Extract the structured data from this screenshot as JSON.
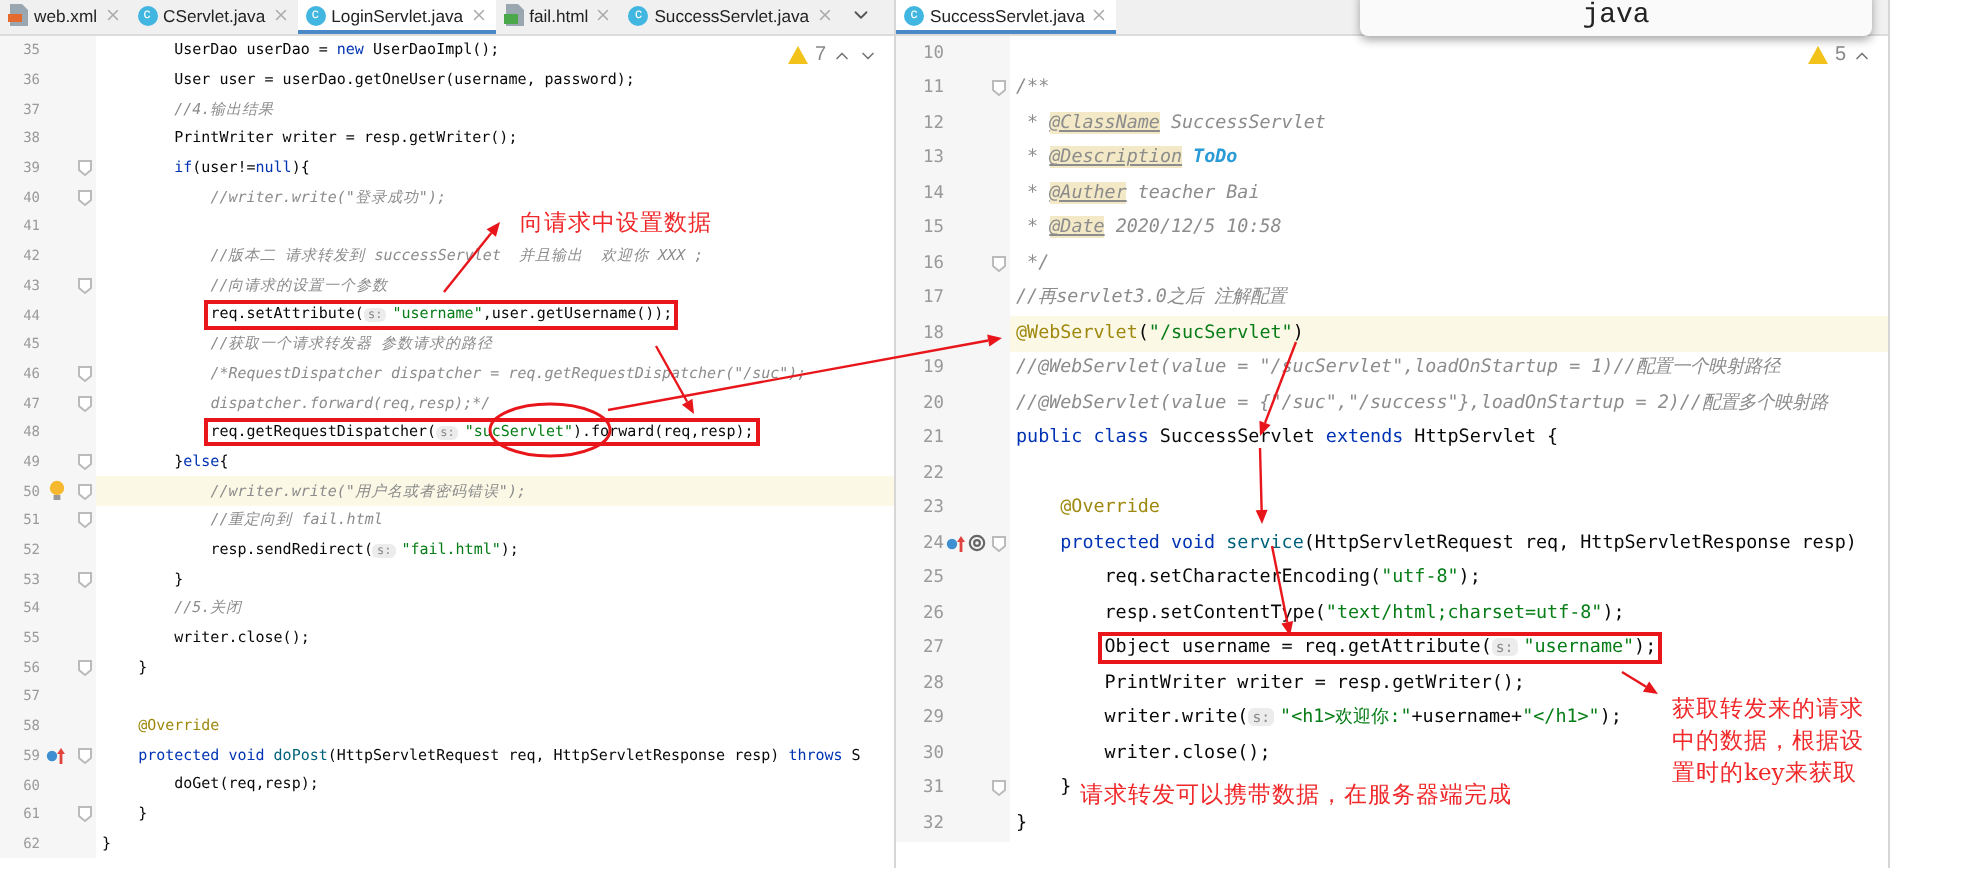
{
  "popup": {
    "text": "java"
  },
  "left_pane": {
    "tabs": [
      {
        "label": "web.xml",
        "kind": "xml",
        "selected": false
      },
      {
        "label": "CServlet.java",
        "kind": "java",
        "icon_text": "c",
        "selected": false
      },
      {
        "label": "LoginServlet.java",
        "kind": "java",
        "icon_text": "c",
        "selected": true
      },
      {
        "label": "fail.html",
        "kind": "html",
        "selected": false
      },
      {
        "label": "SuccessServlet.java",
        "kind": "java",
        "icon_text": "c",
        "selected": false
      }
    ],
    "warnings": "7",
    "lines": [
      {
        "number": "35",
        "segments": [
          {
            "kind": "plain",
            "t": "        UserDao userDao = "
          },
          {
            "kind": "kw",
            "t": "new"
          },
          {
            "kind": "plain",
            "t": " UserDaoImpl();"
          }
        ]
      },
      {
        "number": "36",
        "segments": [
          {
            "kind": "plain",
            "t": "        User user = userDao.getOneUser(username, password);"
          }
        ]
      },
      {
        "number": "37",
        "segments": [
          {
            "kind": "comment",
            "t": "        //4.输出结果"
          }
        ]
      },
      {
        "number": "38",
        "segments": [
          {
            "kind": "plain",
            "t": "        PrintWriter writer = resp.getWriter();"
          }
        ]
      },
      {
        "number": "39",
        "fold": true,
        "segments": [
          {
            "kind": "kw",
            "t": "        if"
          },
          {
            "kind": "plain",
            "t": "(user!="
          },
          {
            "kind": "kw",
            "t": "null"
          },
          {
            "kind": "plain",
            "t": "){"
          }
        ]
      },
      {
        "number": "40",
        "fold": true,
        "segments": [
          {
            "kind": "comment",
            "t": "            //writer.write(\"登录成功\");"
          }
        ]
      },
      {
        "number": "41"
      },
      {
        "number": "42",
        "segments": [
          {
            "kind": "comment",
            "t": "            //版本二 请求转发到 successServlet  并且输出  欢迎你 XXX ;"
          }
        ]
      },
      {
        "number": "43",
        "fold": true,
        "segments": [
          {
            "kind": "comment",
            "t": "            //向请求的设置一个参数"
          }
        ]
      },
      {
        "number": "44",
        "boxed": true,
        "segments": [
          {
            "kind": "plain",
            "t": "            req.setAttribute("
          },
          {
            "kind": "hint",
            "t": "s:"
          },
          {
            "kind": "str",
            "t": "\"username\""
          },
          {
            "kind": "plain",
            "t": ",user.getUsername());"
          }
        ]
      },
      {
        "number": "45",
        "segments": [
          {
            "kind": "comment",
            "t": "            //获取一个请求转发器 参数请求的路径"
          }
        ]
      },
      {
        "number": "46",
        "fold": true,
        "segments": [
          {
            "kind": "comment",
            "t": "            /*RequestDispatcher dispatcher = req.getRequestDispatcher(\"/suc\");"
          }
        ]
      },
      {
        "number": "47",
        "fold": true,
        "segments": [
          {
            "kind": "comment",
            "t": "            dispatcher.forward(req,resp);*/"
          }
        ]
      },
      {
        "number": "48",
        "boxed": true,
        "segments": [
          {
            "kind": "plain",
            "t": "            req.getRequestDispatcher("
          },
          {
            "kind": "hint",
            "t": "s:"
          },
          {
            "kind": "str",
            "t": "\"sucServlet\""
          },
          {
            "kind": "plain",
            "t": ").forward(req,resp);"
          }
        ]
      },
      {
        "number": "49",
        "fold": true,
        "segments": [
          {
            "kind": "plain",
            "t": "        }"
          },
          {
            "kind": "kw",
            "t": "else"
          },
          {
            "kind": "plain",
            "t": "{"
          }
        ]
      },
      {
        "number": "50",
        "fold": true,
        "highlight": true,
        "gutter": {
          "kind": "bulb"
        },
        "segments": [
          {
            "kind": "comment",
            "t": "            //writer.write(\"用户名或者密码错误\");"
          }
        ]
      },
      {
        "number": "51",
        "fold": true,
        "segments": [
          {
            "kind": "comment",
            "t": "            //重定向到 fail.html"
          }
        ]
      },
      {
        "number": "52",
        "segments": [
          {
            "kind": "plain",
            "t": "            resp.sendRedirect("
          },
          {
            "kind": "hint",
            "t": "s:"
          },
          {
            "kind": "str",
            "t": "\"fail.html\""
          },
          {
            "kind": "plain",
            "t": ");"
          }
        ]
      },
      {
        "number": "53",
        "fold": true,
        "segments": [
          {
            "kind": "plain",
            "t": "        }"
          }
        ]
      },
      {
        "number": "54",
        "segments": [
          {
            "kind": "comment",
            "t": "        //5.关闭"
          }
        ]
      },
      {
        "number": "55",
        "segments": [
          {
            "kind": "plain",
            "t": "        writer.close();"
          }
        ]
      },
      {
        "number": "56",
        "fold": true,
        "segments": [
          {
            "kind": "plain",
            "t": "    }"
          }
        ]
      },
      {
        "number": "57"
      },
      {
        "number": "58",
        "segments": [
          {
            "kind": "ann",
            "t": "    @Override"
          }
        ]
      },
      {
        "number": "59",
        "fold": true,
        "gutter": {
          "kind": "override"
        },
        "segments": [
          {
            "kind": "kw",
            "t": "    protected void "
          },
          {
            "kind": "method",
            "t": "doPost"
          },
          {
            "kind": "plain",
            "t": "(HttpServletRequest req, HttpServletResponse resp) "
          },
          {
            "kind": "kw",
            "t": "throws"
          },
          {
            "kind": "plain",
            "t": " S"
          }
        ]
      },
      {
        "number": "60",
        "segments": [
          {
            "kind": "plain",
            "t": "        doGet(req,resp);"
          }
        ]
      },
      {
        "number": "61",
        "fold": true,
        "segments": [
          {
            "kind": "plain",
            "t": "    }"
          }
        ]
      },
      {
        "number": "62",
        "segments": [
          {
            "kind": "plain",
            "t": "}"
          }
        ]
      }
    ]
  },
  "right_pane": {
    "tabs": [
      {
        "label": "SuccessServlet.java",
        "kind": "java",
        "icon_text": "c",
        "selected": true
      }
    ],
    "warnings": "5",
    "lines": [
      {
        "number": "10"
      },
      {
        "number": "11",
        "fold": true,
        "segments": [
          {
            "kind": "comment",
            "t": "/**"
          }
        ]
      },
      {
        "number": "12",
        "segments": [
          {
            "kind": "comment",
            "t": " * "
          },
          {
            "kind": "doctag",
            "t": "@ClassName"
          },
          {
            "kind": "comment",
            "t": " SuccessServlet"
          }
        ]
      },
      {
        "number": "13",
        "segments": [
          {
            "kind": "comment",
            "t": " * "
          },
          {
            "kind": "doctag",
            "t": "@Description"
          },
          {
            "kind": "todo",
            "t": " ToDo"
          }
        ]
      },
      {
        "number": "14",
        "segments": [
          {
            "kind": "comment",
            "t": " * "
          },
          {
            "kind": "doctag",
            "t": "@Auther"
          },
          {
            "kind": "comment",
            "t": " teacher Bai"
          }
        ]
      },
      {
        "number": "15",
        "segments": [
          {
            "kind": "comment",
            "t": " * "
          },
          {
            "kind": "doctag",
            "t": "@Date"
          },
          {
            "kind": "comment",
            "t": " 2020/12/5 10:58"
          }
        ]
      },
      {
        "number": "16",
        "fold": true,
        "segments": [
          {
            "kind": "comment",
            "t": " */"
          }
        ]
      },
      {
        "number": "17",
        "segments": [
          {
            "kind": "comment",
            "t": "//再servlet3.0之后 注解配置"
          }
        ]
      },
      {
        "number": "18",
        "highlight": true,
        "segments": [
          {
            "kind": "ann",
            "t": "@WebServlet"
          },
          {
            "kind": "plain",
            "t": "("
          },
          {
            "kind": "str",
            "t": "\"/sucServlet\""
          },
          {
            "kind": "plain",
            "t": ")"
          }
        ]
      },
      {
        "number": "19",
        "segments": [
          {
            "kind": "comment",
            "t": "//@WebServlet(value = \"/sucServlet\",loadOnStartup = 1)//配置一个映射路径"
          }
        ]
      },
      {
        "number": "20",
        "segments": [
          {
            "kind": "comment",
            "t": "//@WebServlet(value = {\"/suc\",\"/success\"},loadOnStartup = 2)//配置多个映射路"
          }
        ]
      },
      {
        "number": "21",
        "segments": [
          {
            "kind": "kw",
            "t": "public class "
          },
          {
            "kind": "plain",
            "t": "SuccessServlet "
          },
          {
            "kind": "kw",
            "t": "extends"
          },
          {
            "kind": "plain",
            "t": " HttpServlet {"
          }
        ]
      },
      {
        "number": "22"
      },
      {
        "number": "23",
        "segments": [
          {
            "kind": "ann",
            "t": "    @Override"
          }
        ]
      },
      {
        "number": "24",
        "fold": true,
        "gutter": {
          "kind": "override_at"
        },
        "segments": [
          {
            "kind": "kw",
            "t": "    protected void "
          },
          {
            "kind": "method",
            "t": "service"
          },
          {
            "kind": "plain",
            "t": "(HttpServletRequest req, HttpServletResponse resp)"
          }
        ]
      },
      {
        "number": "25",
        "segments": [
          {
            "kind": "plain",
            "t": "        req.setCharacterEncoding("
          },
          {
            "kind": "str",
            "t": "\"utf-8\""
          },
          {
            "kind": "plain",
            "t": ");"
          }
        ]
      },
      {
        "number": "26",
        "segments": [
          {
            "kind": "plain",
            "t": "        resp.setContentType("
          },
          {
            "kind": "str",
            "t": "\"text/html;charset=utf-8\""
          },
          {
            "kind": "plain",
            "t": ");"
          }
        ]
      },
      {
        "number": "27",
        "boxed": true,
        "segments": [
          {
            "kind": "plain",
            "t": "        Object username = req.getAttribute("
          },
          {
            "kind": "hint",
            "t": "s:"
          },
          {
            "kind": "str",
            "t": "\"username\""
          },
          {
            "kind": "plain",
            "t": ");"
          }
        ]
      },
      {
        "number": "28",
        "segments": [
          {
            "kind": "plain",
            "t": "        PrintWriter writer = resp.getWriter();"
          }
        ]
      },
      {
        "number": "29",
        "segments": [
          {
            "kind": "plain",
            "t": "        writer.write("
          },
          {
            "kind": "hint",
            "t": "s:"
          },
          {
            "kind": "str",
            "t": "\"<h1>欢迎你:\""
          },
          {
            "kind": "plain",
            "t": "+username+"
          },
          {
            "kind": "str",
            "t": "\"</h1>\""
          },
          {
            "kind": "plain",
            "t": ");"
          }
        ]
      },
      {
        "number": "30",
        "segments": [
          {
            "kind": "plain",
            "t": "        writer.close();"
          }
        ]
      },
      {
        "number": "31",
        "fold": true,
        "segments": [
          {
            "kind": "plain",
            "t": "    }"
          }
        ]
      },
      {
        "number": "32",
        "segments": [
          {
            "kind": "plain",
            "t": "}"
          }
        ]
      }
    ]
  },
  "notes": [
    {
      "text": "向请求中设置数据"
    },
    {
      "text": "请求转发可以携带数据，在服务器端完成"
    },
    {
      "text": "获取转发来的请求中的数据，根据设置时的key来获取"
    }
  ]
}
